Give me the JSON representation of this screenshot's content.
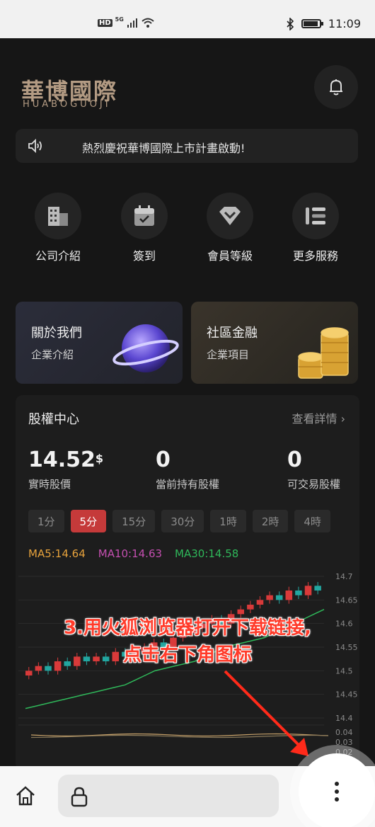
{
  "status_bar": {
    "network_badge": "HD",
    "signal_label": "5G",
    "time": "11:09"
  },
  "header": {
    "logo_cn": "華博國際",
    "logo_en": "HUABOGUOJI",
    "bell_icon": "bell-icon"
  },
  "notice": {
    "icon": "speaker-icon",
    "text": "熱烈慶祝華博國際上市計畫啟動!"
  },
  "quick_nav": [
    {
      "label": "公司介紹",
      "icon": "building-icon"
    },
    {
      "label": "簽到",
      "icon": "calendar-check-icon"
    },
    {
      "label": "會員等級",
      "icon": "diamond-icon"
    },
    {
      "label": "更多服務",
      "icon": "list-icon"
    }
  ],
  "cards": [
    {
      "title": "關於我們",
      "subtitle": "企業介紹",
      "icon": "planet-icon"
    },
    {
      "title": "社區金融",
      "subtitle": "企業項目",
      "icon": "coins-icon"
    }
  ],
  "stock": {
    "title": "股權中心",
    "more": "查看詳情",
    "stats": [
      {
        "value": "14.52",
        "unit": "$",
        "label": "實時股價"
      },
      {
        "value": "0",
        "unit": "",
        "label": "當前持有股權"
      },
      {
        "value": "0",
        "unit": "",
        "label": "可交易股權"
      }
    ],
    "tabs": [
      "1分",
      "5分",
      "15分",
      "30分",
      "1時",
      "2時",
      "4時"
    ],
    "active_tab": "5分",
    "ma": [
      {
        "label": "MA5:14.64",
        "color": "#e6a23c"
      },
      {
        "label": "MA10:14.63",
        "color": "#c44fb0"
      },
      {
        "label": "MA30:14.58",
        "color": "#2fb85a"
      }
    ]
  },
  "chart_data": {
    "type": "candlestick",
    "y_ticks": [
      "14.7",
      "14.65",
      "14.6",
      "14.55",
      "14.5",
      "14.45",
      "14.4"
    ],
    "ylim": [
      14.4,
      14.7
    ],
    "close_ma30": [
      14.42,
      14.425,
      14.43,
      14.435,
      14.44,
      14.445,
      14.45,
      14.455,
      14.46,
      14.465,
      14.47,
      14.48,
      14.49,
      14.5,
      14.505,
      14.51,
      14.515,
      14.52,
      14.53,
      14.54,
      14.55,
      14.555,
      14.56,
      14.565,
      14.57,
      14.58,
      14.59,
      14.6,
      14.61,
      14.62,
      14.63
    ],
    "candles": [
      [
        14.49,
        14.5
      ],
      [
        14.5,
        14.51
      ],
      [
        14.51,
        14.5
      ],
      [
        14.5,
        14.52
      ],
      [
        14.52,
        14.51
      ],
      [
        14.51,
        14.53
      ],
      [
        14.53,
        14.52
      ],
      [
        14.52,
        14.53
      ],
      [
        14.53,
        14.52
      ],
      [
        14.52,
        14.54
      ],
      [
        14.54,
        14.53
      ],
      [
        14.53,
        14.54
      ],
      [
        14.54,
        14.55
      ],
      [
        14.55,
        14.56
      ],
      [
        14.56,
        14.55
      ],
      [
        14.55,
        14.57
      ],
      [
        14.57,
        14.58
      ],
      [
        14.58,
        14.59
      ],
      [
        14.59,
        14.6
      ],
      [
        14.6,
        14.61
      ],
      [
        14.61,
        14.6
      ],
      [
        14.6,
        14.62
      ],
      [
        14.62,
        14.63
      ],
      [
        14.63,
        14.64
      ],
      [
        14.64,
        14.65
      ],
      [
        14.65,
        14.66
      ],
      [
        14.66,
        14.65
      ],
      [
        14.65,
        14.67
      ],
      [
        14.67,
        14.66
      ],
      [
        14.66,
        14.68
      ],
      [
        14.68,
        14.67
      ]
    ],
    "sub_ticks": [
      "0.04",
      "0.03",
      "0.02"
    ]
  },
  "overlay": {
    "line1": "3.用火狐浏览器打开下载链接,",
    "line2": "点击右下角图标"
  },
  "bottom_bar": {
    "home_icon": "home-icon",
    "lock_icon": "lock-icon",
    "menu_icon": "more-vertical-icon"
  }
}
